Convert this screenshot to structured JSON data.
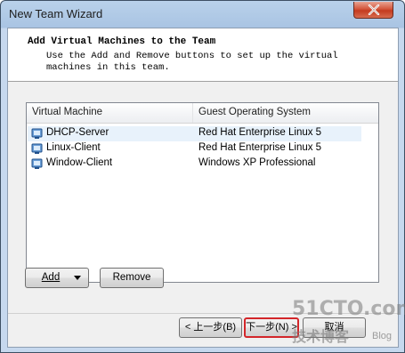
{
  "window": {
    "title": "New Team Wizard"
  },
  "header": {
    "title": "Add Virtual Machines to the Team",
    "description": "Use the Add and Remove buttons to set up the virtual machines in this team."
  },
  "list": {
    "columns": [
      "Virtual Machine",
      "Guest Operating System"
    ],
    "rows": [
      {
        "name": "DHCP-Server",
        "os": "Red Hat Enterprise Linux 5",
        "selected": true
      },
      {
        "name": "Linux-Client",
        "os": "Red Hat Enterprise Linux 5",
        "selected": false
      },
      {
        "name": "Window-Client",
        "os": "Windows XP Professional",
        "selected": false
      }
    ]
  },
  "buttons": {
    "add": "Add",
    "remove": "Remove",
    "back": "< 上一步(B)",
    "next": "下一步(N) >",
    "cancel": "取消"
  },
  "watermark": {
    "main": "51CTO.com",
    "sub": "技术博客",
    "blog": "Blog"
  },
  "icons": {
    "close": "close-icon",
    "vm": "virtual-machine-icon"
  }
}
